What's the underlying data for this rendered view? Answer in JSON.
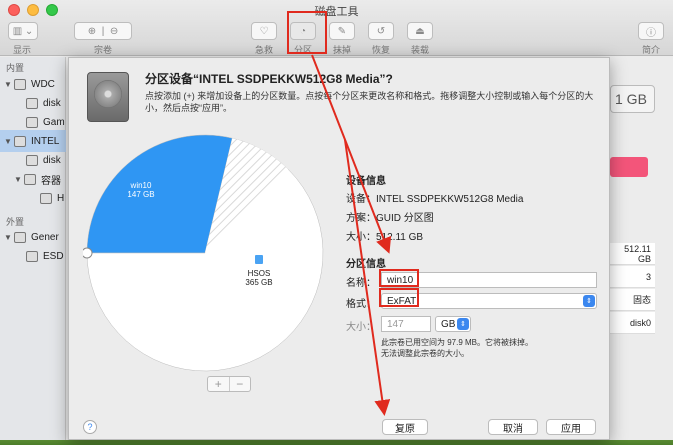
{
  "window": {
    "title": "磁盘工具"
  },
  "toolbar": {
    "display_label": "显示",
    "volume_label": "宗卷",
    "firstaid_label": "急救",
    "partition_label": "分区",
    "erase_label": "抹掉",
    "restore_label": "恢复",
    "mount_label": "装载",
    "info_label": "简介",
    "firstaid_icon": "stethoscope-icon",
    "partition_icon": "pie-icon",
    "erase_icon": "erase-icon",
    "restore_icon": "restore-icon",
    "mount_icon": "mount-icon",
    "info_icon": "info-icon",
    "info_glyph": "ⓘ"
  },
  "sidebar": {
    "internal_header": "内置",
    "external_header": "外置",
    "items": [
      {
        "label": "WDC ",
        "level": 0,
        "selected": false
      },
      {
        "label": "disk",
        "level": 1,
        "selected": false
      },
      {
        "label": "Gam",
        "level": 1,
        "selected": false
      },
      {
        "label": "INTEL",
        "level": 0,
        "selected": true
      },
      {
        "label": "disk",
        "level": 1,
        "selected": false
      },
      {
        "label": "容器",
        "level": 1,
        "selected": false
      },
      {
        "label": "H",
        "level": 2,
        "selected": false
      },
      {
        "label": "Gener",
        "level": 0,
        "selected": false
      },
      {
        "label": "ESD",
        "level": 1,
        "selected": false
      }
    ]
  },
  "right_pane": {
    "size_text": "1 GB",
    "cells": [
      "512.11 GB",
      "3",
      "固态",
      "disk0"
    ]
  },
  "sheet": {
    "title": "分区设备“INTEL SSDPEKKW512G8 Media”?",
    "description": "点按添加 (+) 来增加设备上的分区数量。点按每个分区来更改名称和格式。拖移调整大小控制或输入每个分区的大小，然后点按“应用”。",
    "pie": {
      "slices": [
        {
          "name": "win10",
          "size": "147 GB",
          "value": 147,
          "color": "#2f96f3"
        },
        {
          "name": "HSOS",
          "size": "365 GB",
          "value": 365,
          "color": "#ffffff"
        }
      ],
      "add_label": "+",
      "remove_label": "−"
    },
    "device_info": {
      "header": "设备信息",
      "device_key": "设备：",
      "device_val": "INTEL SSDPEKKW512G8 Media",
      "scheme_key": "方案：",
      "scheme_val": "GUID 分区图",
      "size_key": "大小：",
      "size_val": "512.11 GB"
    },
    "partition_info": {
      "header": "分区信息",
      "name_key": "名称：",
      "name_val": "win10",
      "format_key": "格式：",
      "format_val": "ExFAT",
      "size_key": "大小：",
      "size_val": "147",
      "unit_val": "GB",
      "hint_line1": "此宗卷已用空间为 97.9 MB。它将被抹掉。",
      "hint_line2": "无法调整此宗卷的大小。"
    },
    "buttons": {
      "help": "?",
      "revert": "复原",
      "cancel": "取消",
      "apply": "应用"
    }
  },
  "annotations": {
    "highlight_color": "#e02a1e"
  }
}
